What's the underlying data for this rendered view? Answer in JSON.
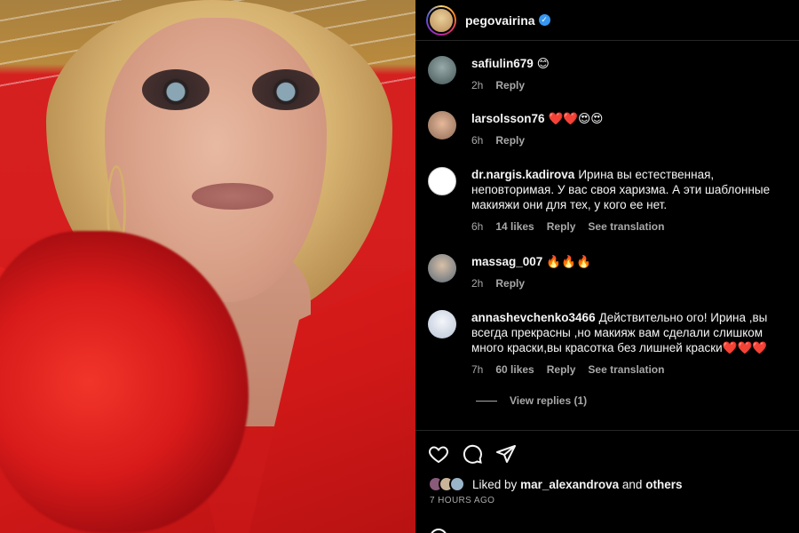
{
  "header": {
    "username": "pegovairina"
  },
  "comments": [
    {
      "user": "safiulin679",
      "text": "😊",
      "time": "2h",
      "likes": "",
      "reply": "Reply",
      "translation": ""
    },
    {
      "user": "larsolsson76",
      "text": "❤️❤️😍😍",
      "time": "6h",
      "likes": "",
      "reply": "Reply",
      "translation": ""
    },
    {
      "user": "dr.nargis.kadirova",
      "text": "Ирина вы естественная, неповторимая. У вас своя харизма. А эти шаблонные макияжи они для тех, у кого ее нет.",
      "time": "6h",
      "likes": "14 likes",
      "reply": "Reply",
      "translation": "See translation"
    },
    {
      "user": "massag_007",
      "text": "🔥🔥🔥",
      "time": "2h",
      "likes": "",
      "reply": "Reply",
      "translation": ""
    },
    {
      "user": "annashevchenko3466",
      "text": "Действительно ого! Ирина ,вы всегда прекрасны ,но макияж вам сделали слишком много краски,вы красотка без лишней краски❤️❤️❤️",
      "time": "7h",
      "likes": "60 likes",
      "reply": "Reply",
      "translation": "See translation"
    }
  ],
  "view_replies": "View replies (1)",
  "likes": {
    "prefix": "Liked by",
    "user": "mar_alexandrova",
    "and": "and",
    "others": "others"
  },
  "timestamp": "7 HOURS AGO",
  "colors": {
    "background": "#000000",
    "text": "#f5f5f5",
    "muted": "#a8a8a8",
    "verified": "#3897f0"
  }
}
